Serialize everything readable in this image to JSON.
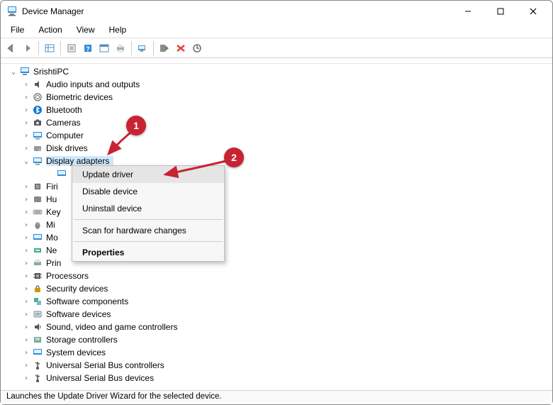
{
  "window": {
    "title": "Device Manager"
  },
  "menu": {
    "file": "File",
    "action": "Action",
    "view": "View",
    "help": "Help"
  },
  "tree": {
    "root": "SrishtiPC",
    "items": [
      {
        "label": "Audio inputs and outputs"
      },
      {
        "label": "Biometric devices"
      },
      {
        "label": "Bluetooth"
      },
      {
        "label": "Cameras"
      },
      {
        "label": "Computer"
      },
      {
        "label": "Disk drives"
      },
      {
        "label": "Display adapters"
      },
      {
        "label": "Firi"
      },
      {
        "label": "Hu"
      },
      {
        "label": "Key"
      },
      {
        "label": "Mi"
      },
      {
        "label": "Mo"
      },
      {
        "label": "Ne"
      },
      {
        "label": "Prin"
      },
      {
        "label": "Processors"
      },
      {
        "label": "Security devices"
      },
      {
        "label": "Software components"
      },
      {
        "label": "Software devices"
      },
      {
        "label": "Sound, video and game controllers"
      },
      {
        "label": "Storage controllers"
      },
      {
        "label": "System devices"
      },
      {
        "label": "Universal Serial Bus controllers"
      },
      {
        "label": "Universal Serial Bus devices"
      }
    ]
  },
  "context_menu": {
    "update": "Update driver",
    "disable": "Disable device",
    "uninstall": "Uninstall device",
    "scan": "Scan for hardware changes",
    "properties": "Properties"
  },
  "status": "Launches the Update Driver Wizard for the selected device.",
  "annotations": {
    "b1": "1",
    "b2": "2"
  }
}
